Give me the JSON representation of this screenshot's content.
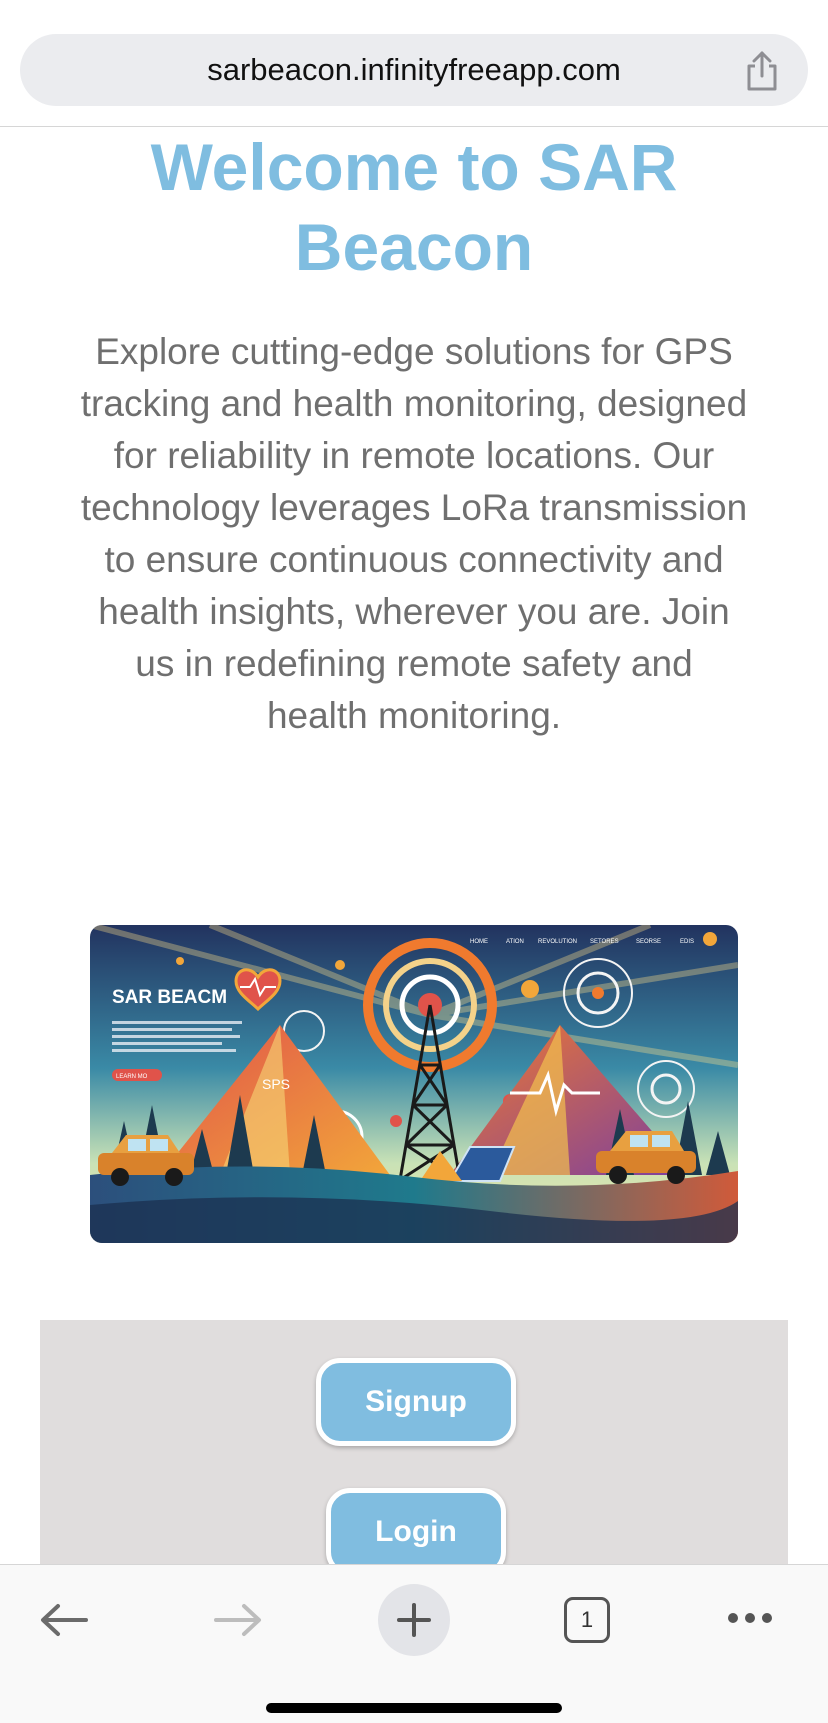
{
  "browser": {
    "url": "sarbeacon.infinityfreeapp.com",
    "tab_count": "1"
  },
  "page": {
    "title_line1": "Welcome to SAR",
    "title_line2": "Beacon",
    "intro": "Explore cutting-edge solutions for GPS tracking and health monitoring, designed for reliability in remote locations. Our technology leverages LoRa transmission to ensure continuous connectivity and health insights, wherever you are. Join us in redefining remote safety and health monitoring.",
    "hero_image": {
      "brand_text": "SAR BEACM",
      "nav_items": [
        "HOME",
        "ATION",
        "REVOLUTION",
        "SETORES",
        "SEORSE",
        "EDIS"
      ],
      "cta_label": "LEARN MO",
      "badge_text": "SPS"
    },
    "actions": {
      "signup_label": "Signup",
      "login_label": "Login"
    }
  },
  "colors": {
    "title": "#7fbde0",
    "button_bg": "#80bde0",
    "panel_bg": "#e0dddd",
    "text_gray": "#6f6f6f"
  }
}
